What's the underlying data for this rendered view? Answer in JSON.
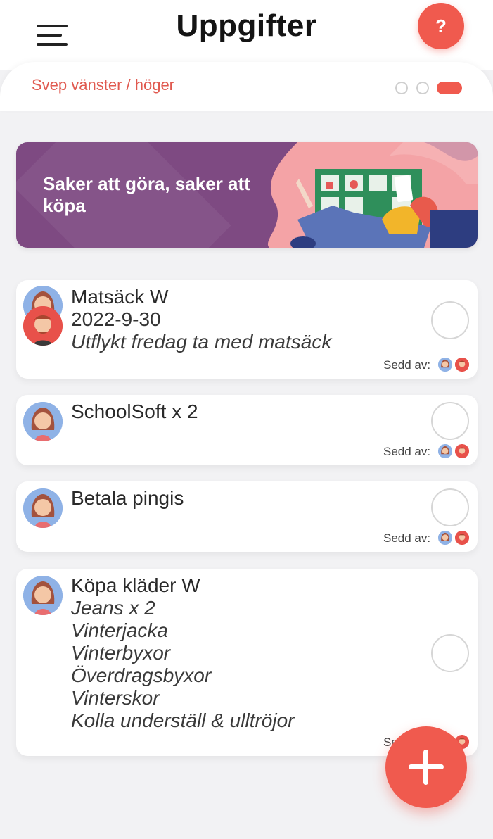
{
  "header": {
    "title": "Uppgifter",
    "menu_icon": "hamburger-menu-icon",
    "help_label": "?"
  },
  "swipe": {
    "label": "Svep vänster / höger",
    "pages": 3,
    "active_page": 3
  },
  "banner": {
    "text": "Saker att göra, saker att köpa"
  },
  "seen_label": "Sedd av:",
  "tasks": [
    {
      "title": "Matsäck W",
      "date": "2022-9-30",
      "note": "Utflykt fredag ta med matsäck"
    },
    {
      "title": "SchoolSoft x 2"
    },
    {
      "title": "Betala pingis"
    },
    {
      "title": "Köpa kläder W",
      "items": [
        "Jeans x 2",
        "Vinterjacka",
        "Vinterbyxor",
        "Överdragsbyxor",
        "Vinterskor",
        "Kolla underställ & ulltröjor"
      ]
    }
  ],
  "colors": {
    "accent": "#f05a4e",
    "banner": "#7e4a82",
    "background": "#f2f2f4"
  },
  "fab_icon": "plus-icon"
}
